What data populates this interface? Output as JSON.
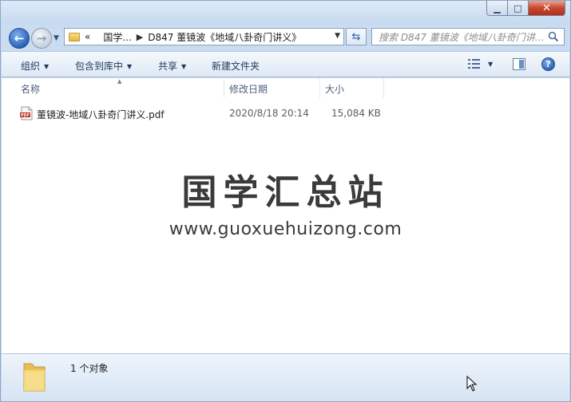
{
  "window": {
    "controls": {
      "minimize": "▁",
      "maximize": "□",
      "close": "✕"
    }
  },
  "nav": {
    "back_icon": "arrow-left-icon",
    "forward_icon": "arrow-right-icon",
    "chevron": "«",
    "breadcrumbs": [
      "国学...",
      "D847 董镜波《地域八卦奇门讲义》"
    ],
    "crumb_separator": "▶",
    "search_placeholder": "搜索 D847 董镜波《地域八卦奇门讲..."
  },
  "toolbar": {
    "organize": "组织",
    "include_in_library": "包含到库中",
    "share": "共享",
    "new_folder": "新建文件夹"
  },
  "columns": {
    "name": "名称",
    "date_modified": "修改日期",
    "size": "大小"
  },
  "files": [
    {
      "name": "董镜波-地域八卦奇门讲义.pdf",
      "date": "2020/8/18 20:14",
      "size": "15,084 KB",
      "type_label": "PDF"
    }
  ],
  "watermark": {
    "cn": "国学汇总站",
    "url": "www.guoxuehuizong.com"
  },
  "status": {
    "count": "1 个对象"
  },
  "colors": {
    "accent": "#2a62b8",
    "titlebar": "#c6d9f0",
    "close": "#c8462e"
  }
}
